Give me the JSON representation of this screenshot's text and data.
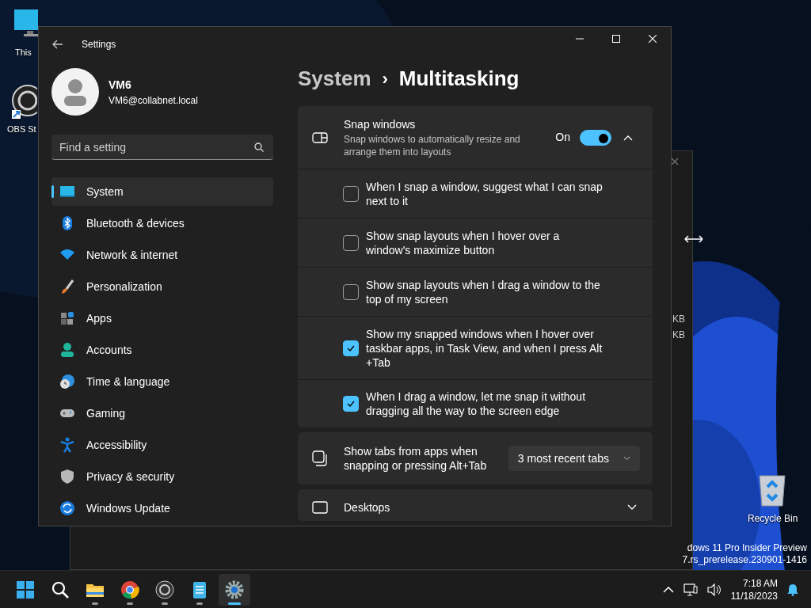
{
  "desktop_icons": [
    {
      "label": "This"
    },
    {
      "label": "OBS St"
    },
    {
      "label": "Recycle Bin"
    }
  ],
  "background_window": {
    "texts": [
      "KB",
      "KB"
    ]
  },
  "settings_window": {
    "title": "Settings",
    "user": {
      "name": "VM6",
      "email": "VM6@collabnet.local"
    },
    "search": {
      "placeholder": "Find a setting"
    },
    "nav_items": [
      {
        "label": "System",
        "selected": true
      },
      {
        "label": "Bluetooth & devices",
        "selected": false
      },
      {
        "label": "Network & internet",
        "selected": false
      },
      {
        "label": "Personalization",
        "selected": false
      },
      {
        "label": "Apps",
        "selected": false
      },
      {
        "label": "Accounts",
        "selected": false
      },
      {
        "label": "Time & language",
        "selected": false
      },
      {
        "label": "Gaming",
        "selected": false
      },
      {
        "label": "Accessibility",
        "selected": false
      },
      {
        "label": "Privacy & security",
        "selected": false
      },
      {
        "label": "Windows Update",
        "selected": false
      }
    ],
    "breadcrumb": {
      "parent": "System",
      "separator": "›",
      "current": "Multitasking"
    },
    "snap_windows": {
      "title": "Snap windows",
      "description": "Snap windows to automatically resize and arrange them into layouts",
      "toggle_label": "On",
      "on": true,
      "expanded": true,
      "options": [
        {
          "label": "When I snap a window, suggest what I can snap next to it",
          "checked": false
        },
        {
          "label": "Show snap layouts when I hover over a window's maximize button",
          "checked": false
        },
        {
          "label": "Show snap layouts when I drag a window to the top of my screen",
          "checked": false
        },
        {
          "label": "Show my snapped windows when I hover over taskbar apps, in Task View, and when I press Alt +Tab",
          "checked": true
        },
        {
          "label": "When I drag a window, let me snap it without dragging all the way to the screen edge",
          "checked": true
        }
      ]
    },
    "show_tabs": {
      "label": "Show tabs from apps when snapping or pressing Alt+Tab",
      "value": "3 most recent tabs"
    },
    "desktops": {
      "title": "Desktops",
      "expanded": false
    }
  },
  "build_info": [
    "dows 11 Pro Insider Preview",
    "7.rs_prerelease.230901-1416"
  ],
  "taskbar": {
    "apps": [
      {
        "kind": "start",
        "running": false,
        "selected": false
      },
      {
        "kind": "search",
        "running": false,
        "selected": false
      },
      {
        "kind": "explorer",
        "running": true,
        "selected": false
      },
      {
        "kind": "chrome",
        "running": true,
        "selected": false
      },
      {
        "kind": "obs",
        "running": true,
        "selected": false
      },
      {
        "kind": "notepad",
        "running": true,
        "selected": false
      },
      {
        "kind": "settings",
        "running": true,
        "selected": true
      }
    ],
    "time": "7:18 AM",
    "date": "11/18/2023"
  }
}
